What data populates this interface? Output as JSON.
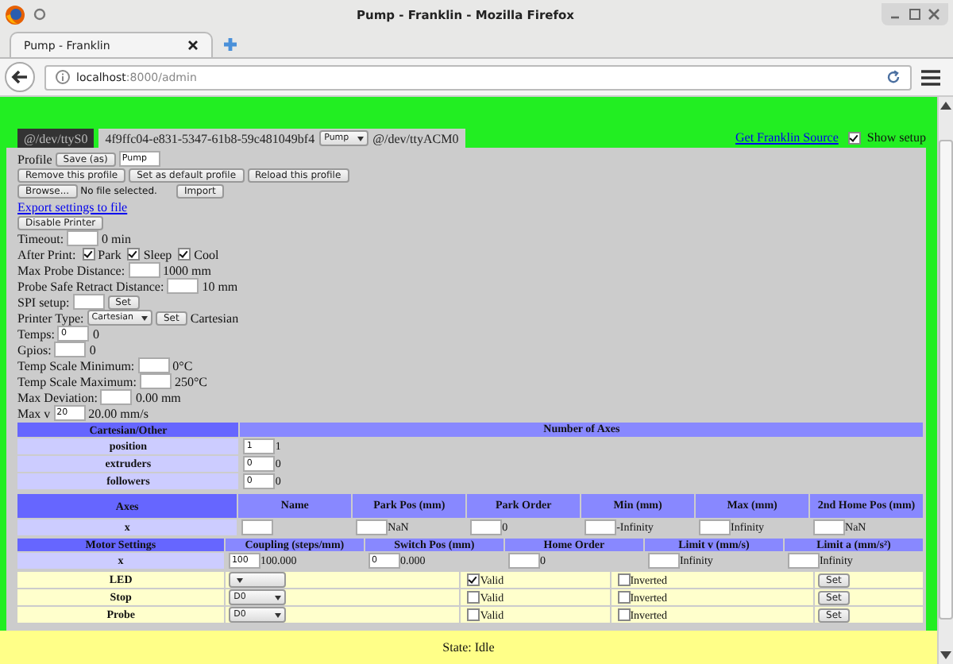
{
  "window": {
    "title": "Pump - Franklin - Mozilla Firefox"
  },
  "browser_tab": {
    "title": "Pump - Franklin"
  },
  "address_bar": {
    "host": "localhost",
    "path": ":8000/admin"
  },
  "printer_tabs": [
    {
      "label": "@/dev/ttyS0",
      "selected": false
    },
    {
      "label": "4f9ffc04-e831-5347-61b8-59c481049bf4",
      "profile": "Pump",
      "port": "@/dev/ttyACM0",
      "selected": true
    }
  ],
  "source_link": "Get Franklin Source",
  "show_setup": {
    "label": "Show setup",
    "checked": true
  },
  "profile": {
    "label": "Profile",
    "save_button": "Save (as)",
    "name": "Pump"
  },
  "profile_buttons": [
    "Remove this profile",
    "Set as default profile",
    "Reload this profile"
  ],
  "import": {
    "browse": "Browse...",
    "file_status": "No file selected.",
    "button": "Import"
  },
  "export_link": "Export settings to file",
  "disable_button": "Disable Printer",
  "settings": [
    {
      "kind": "field",
      "label": "Timeout:",
      "suffix": "0 min"
    },
    {
      "kind": "checks",
      "label": "After Print:",
      "options": [
        {
          "label": "Park",
          "checked": true
        },
        {
          "label": "Sleep",
          "checked": true
        },
        {
          "label": "Cool",
          "checked": true
        }
      ]
    },
    {
      "kind": "field",
      "label": "Max Probe Distance:",
      "suffix": "1000 mm"
    },
    {
      "kind": "field",
      "label": "Probe Safe Retract Distance:",
      "suffix": "10 mm"
    },
    {
      "kind": "button",
      "label": "SPI setup:",
      "button": "Set"
    },
    {
      "kind": "select",
      "label": "Printer Type:",
      "select": "Cartesian",
      "button": "Set",
      "suffix": "Cartesian"
    },
    {
      "kind": "field",
      "label": "Temps:",
      "value": "0",
      "suffix": "0"
    },
    {
      "kind": "field",
      "label": "Gpios:",
      "suffix": "0"
    },
    {
      "kind": "field",
      "label": "Temp Scale Minimum:",
      "suffix": "0°C"
    },
    {
      "kind": "field",
      "label": "Temp Scale Maximum:",
      "suffix": "250°C"
    },
    {
      "kind": "field",
      "label": "Max Deviation:",
      "suffix": "0.00 mm"
    },
    {
      "kind": "field",
      "label": "Max v",
      "value": "20",
      "suffix": "20.00 mm/s"
    }
  ],
  "cartesian_table": {
    "header": "Cartesian/Other",
    "count_header": "Number of Axes",
    "rows": [
      {
        "label": "position",
        "value": "1",
        "reading": "1"
      },
      {
        "label": "extruders",
        "value": "0",
        "reading": "0"
      },
      {
        "label": "followers",
        "value": "0",
        "reading": "0"
      }
    ]
  },
  "axes_table": {
    "columns": [
      "Axes",
      "Name",
      "Park Pos (mm)",
      "Park Order",
      "Min (mm)",
      "Max (mm)",
      "2nd Home Pos (mm)"
    ],
    "rows": [
      [
        {
          "text": "x"
        },
        {},
        {
          "reading": "NaN"
        },
        {
          "reading": "0"
        },
        {
          "reading": "-Infinity"
        },
        {
          "reading": "Infinity"
        },
        {
          "reading": "NaN"
        }
      ]
    ]
  },
  "motor_table": {
    "columns": [
      "Motor Settings",
      "Coupling (steps/mm)",
      "Switch Pos (mm)",
      "Home Order",
      "Limit v (mm/s)",
      "Limit a (mm/s²)"
    ],
    "rows": [
      [
        {
          "text": "x"
        },
        {
          "value": "100",
          "reading": "100.000"
        },
        {
          "value": "0",
          "reading": "0.000"
        },
        {
          "reading": "0"
        },
        {
          "reading": "Infinity"
        },
        {
          "reading": "Infinity"
        }
      ]
    ]
  },
  "gpio_rows": [
    {
      "label": "LED",
      "valid": {
        "label": "Valid",
        "checked": true
      },
      "inverted": {
        "label": "Inverted",
        "checked": false
      },
      "button": "Set"
    },
    {
      "label": "Stop",
      "pin": "D0",
      "valid": {
        "label": "Valid",
        "checked": false
      },
      "inverted": {
        "label": "Inverted",
        "checked": false
      },
      "button": "Set"
    },
    {
      "label": "Probe",
      "pin": "D0",
      "valid": {
        "label": "Valid",
        "checked": false
      },
      "inverted": {
        "label": "Inverted",
        "checked": false
      },
      "button": "Set"
    }
  ],
  "status_bar": "State: Idle"
}
